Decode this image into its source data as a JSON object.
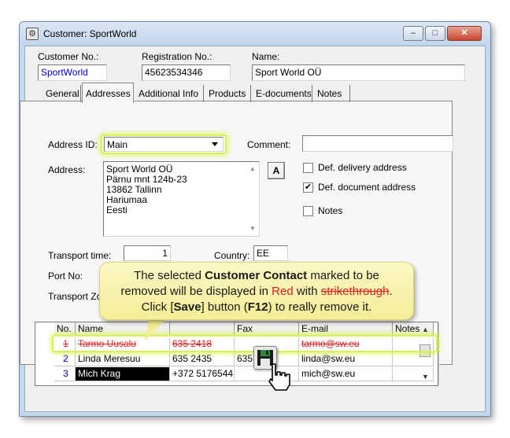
{
  "window": {
    "title": "Customer: SportWorld",
    "app_icon_glyph": "⚙",
    "controls": {
      "minimize": "–",
      "maximize": "□",
      "close": "✕"
    }
  },
  "header": {
    "customer_no": {
      "label": "Customer No.:",
      "value": "SportWorld"
    },
    "registration_no": {
      "label": "Registration No.:",
      "value": "45623534346"
    },
    "name": {
      "label": "Name:",
      "value": "Sport World OÜ"
    }
  },
  "tabs": [
    {
      "label": "General"
    },
    {
      "label": "Addresses",
      "active": true
    },
    {
      "label": "Additional Info"
    },
    {
      "label": "Products"
    },
    {
      "label": "E-documents"
    },
    {
      "label": "Notes"
    }
  ],
  "addresses": {
    "address_id": {
      "label": "Address ID:",
      "value": "Main"
    },
    "comment": {
      "label": "Comment:",
      "value": ""
    },
    "address": {
      "label": "Address:",
      "lines": [
        "Sport World OÜ",
        "Pärnu mnt 124b-23",
        "13862 Tallinn",
        "Hariumaa",
        "Eesti"
      ]
    },
    "a_button": "A",
    "def_delivery": {
      "label": "Def. delivery address",
      "checked": false
    },
    "def_document": {
      "label": "Def. document address",
      "checked": true
    },
    "notes": {
      "label": "Notes",
      "checked": false
    },
    "transport_time": {
      "label": "Transport time:",
      "value": "1"
    },
    "country": {
      "label": "Country:",
      "value": "EE"
    },
    "port_no": {
      "label": "Port No:"
    },
    "transport_zone": {
      "label": "Transport Zo"
    }
  },
  "contacts": {
    "columns": [
      "No.",
      "Name",
      "",
      "Fax",
      "E-mail",
      "Notes"
    ],
    "rows": [
      {
        "no": "1",
        "name": "Tarmo Uusalu",
        "phone": "635 2418",
        "fax": "",
        "email": "tarmo@sw.eu",
        "notes": "",
        "struck": true
      },
      {
        "no": "2",
        "name": "Linda Meresuu",
        "phone": "635 2435",
        "fax": "635",
        "email": "linda@sw.eu",
        "notes": ""
      },
      {
        "no": "3",
        "name": "Mich Krag",
        "phone": "+372 5176544",
        "fax": "",
        "email": "mich@sw.eu",
        "notes": "",
        "selected": true
      }
    ]
  },
  "callout": {
    "line1_pre": "The selected ",
    "line1_bold": "Customer Contact",
    "line1_post": " marked to be",
    "line2_pre": "removed will be displayed in ",
    "line2_red": "Red",
    "line2_mid": " with ",
    "line2_strike": "strikethrough",
    "line2_post": ".",
    "line3_pre": "Click [",
    "line3_bold1": "Save",
    "line3_mid": "] button (",
    "line3_bold2": "F12",
    "line3_post": ") to really remove it."
  },
  "colors": {
    "deleted_red": "#e02020",
    "link_blue": "#0000cc",
    "highlight_yellow": "#d8f05a",
    "selected_bg": "#000000"
  }
}
